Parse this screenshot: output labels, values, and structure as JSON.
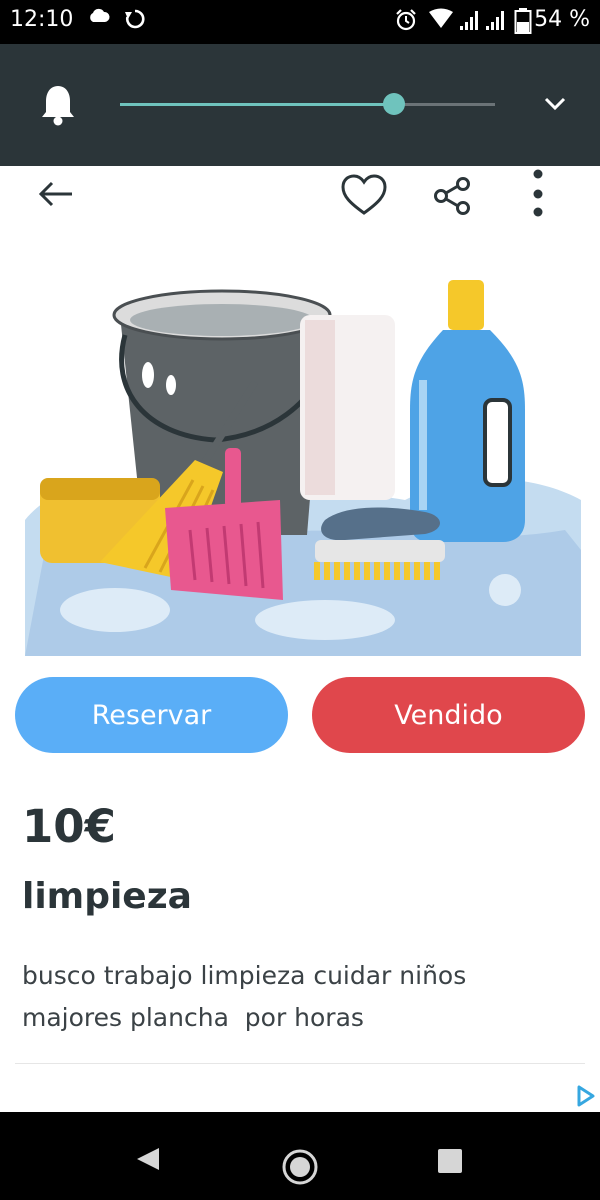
{
  "status_bar": {
    "time": "12:10",
    "battery": "54 %"
  },
  "media": {
    "progress": 0.73
  },
  "product": {
    "reserve_label": "Reservar",
    "sold_label": "Vendido",
    "price": "10€",
    "title": "limpieza",
    "description": "busco trabajo limpieza cuidar niños\nmajores plancha  por horas"
  },
  "colors": {
    "reserve": "#5aaef7",
    "sold": "#e0474c",
    "accent": "#6fc3bd",
    "header": "#2b3539"
  }
}
